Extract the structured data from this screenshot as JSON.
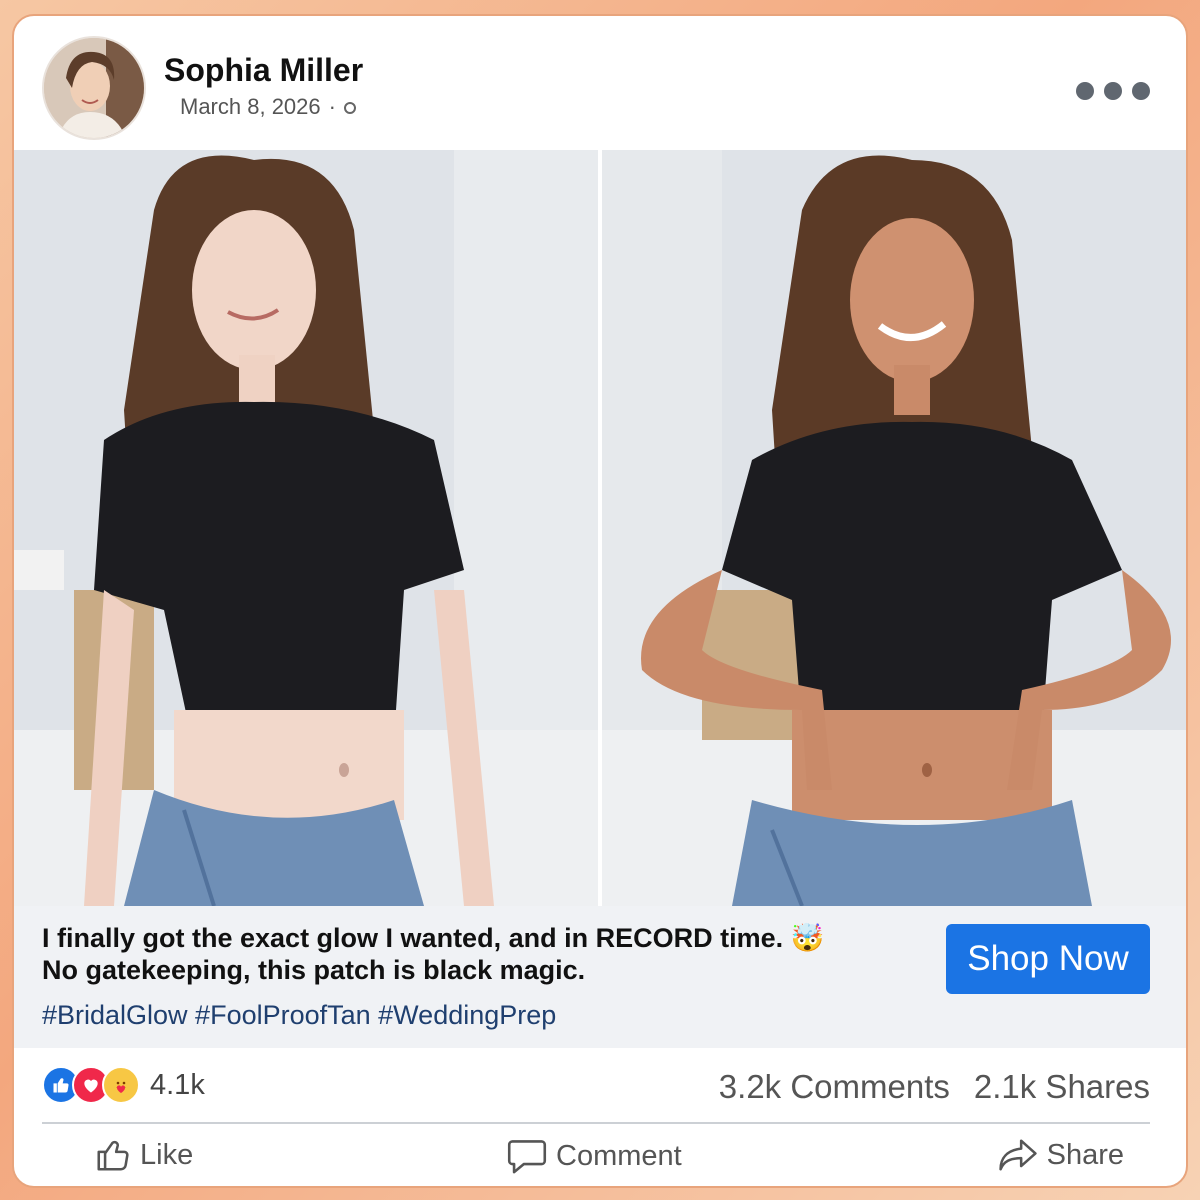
{
  "post": {
    "author": "Sophia Miller",
    "date": "March 8, 2026",
    "separator": "·",
    "privacy_icon": "globe-icon",
    "menu_icon": "more-options-icon"
  },
  "photos": [
    {
      "label": "before-photo",
      "description_icon": "photo"
    },
    {
      "label": "after-photo",
      "description_icon": "photo"
    }
  ],
  "caption": {
    "line1": "I finally got the exact glow I wanted, and in RECORD time. 🤯",
    "line2": "No gatekeeping, this patch is black magic.",
    "hashtags": "#BridalGlow #FoolProofTan #WeddingPrep"
  },
  "cta": {
    "label": "Shop Now",
    "color": "#1b74e4"
  },
  "stats": {
    "reactions_count": "4.1k",
    "comments": "3.2k Comments",
    "shares": "2.1k Shares",
    "reaction_icons": [
      "like-icon",
      "love-icon",
      "care-icon"
    ]
  },
  "actions": {
    "like": "Like",
    "comment": "Comment",
    "share": "Share"
  },
  "colors": {
    "accent": "#1b74e4",
    "frame": "#f3a77e",
    "caption_bg": "#f0f2f5"
  }
}
